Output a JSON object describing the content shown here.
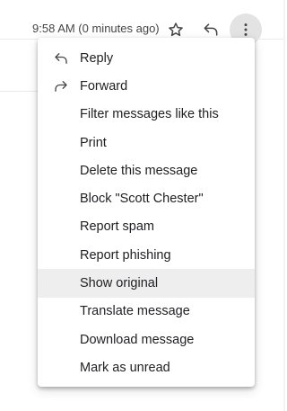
{
  "header": {
    "timestamp": "9:58 AM (0 minutes ago)",
    "icons": [
      "star-icon",
      "reply-icon",
      "more-vert-icon"
    ]
  },
  "menu": {
    "items": [
      {
        "label": "Reply",
        "icon": "reply-icon",
        "highlighted": false
      },
      {
        "label": "Forward",
        "icon": "forward-icon",
        "highlighted": false
      },
      {
        "label": "Filter messages like this",
        "highlighted": false
      },
      {
        "label": "Print",
        "highlighted": false
      },
      {
        "label": "Delete this message",
        "highlighted": false
      },
      {
        "label": "Block \"Scott Chester\"",
        "highlighted": false
      },
      {
        "label": "Report spam",
        "highlighted": false
      },
      {
        "label": "Report phishing",
        "highlighted": false
      },
      {
        "label": "Show original",
        "highlighted": true
      },
      {
        "label": "Translate message",
        "highlighted": false
      },
      {
        "label": "Download message",
        "highlighted": false
      },
      {
        "label": "Mark as unread",
        "highlighted": false
      }
    ]
  },
  "colors": {
    "text": "#202124",
    "secondary_text": "#444746",
    "highlight": "#eeeeee",
    "active_button": "#e3e3e3"
  }
}
